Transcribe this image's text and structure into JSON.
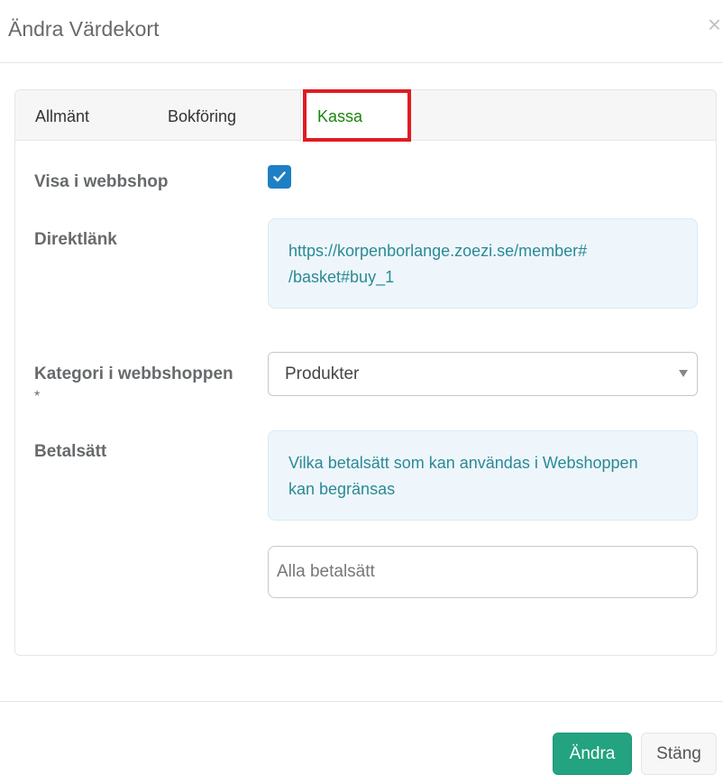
{
  "modal": {
    "title": "Ändra Värdekort",
    "close_label": "×"
  },
  "tabs": [
    {
      "label": "Allmänt",
      "active": false
    },
    {
      "label": "Bokföring",
      "active": false
    },
    {
      "label": "Kassa",
      "active": true
    }
  ],
  "form": {
    "visa_webbshop": {
      "label": "Visa i webbshop",
      "checked": true
    },
    "direktlank": {
      "label": "Direktlänk",
      "url_line1": "https://korpenborlange.zoezi.se/member#",
      "url_line2": "/basket#buy_1"
    },
    "kategori": {
      "label": "Kategori i webbshoppen",
      "required_mark": "*",
      "selected": "Produkter"
    },
    "betalsatt": {
      "label": "Betalsätt",
      "info_line1": "Vilka betalsätt som kan användas i Webshoppen",
      "info_line2": "kan begränsas",
      "placeholder": "Alla betalsätt"
    }
  },
  "footer": {
    "primary_label": "Ändra",
    "close_label": "Stäng"
  },
  "colors": {
    "active_tab": "#18860a",
    "highlight": "#e01b24",
    "primary_button": "#23a37f",
    "checkbox": "#1f7fc4",
    "info_text": "#2a8a95"
  }
}
